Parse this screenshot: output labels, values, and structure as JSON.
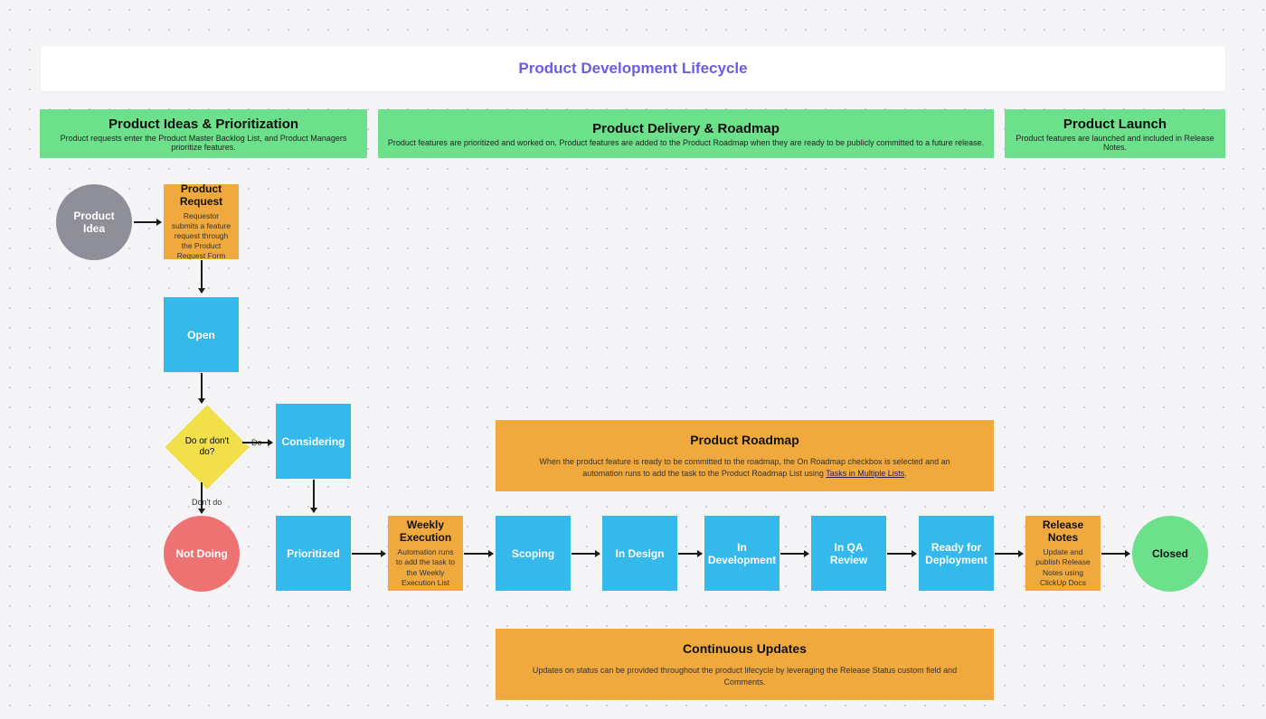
{
  "title": "Product Development Lifecycle",
  "phases": [
    {
      "title": "Product Ideas & Prioritization",
      "sub": "Product requests enter the Product Master Backlog List, and Product Managers prioritize features."
    },
    {
      "title": "Product Delivery & Roadmap",
      "sub": "Product features are prioritized and worked on. Product features are added to the Product Roadmap when they are ready to be publicly committed to a future release."
    },
    {
      "title": "Product Launch",
      "sub": "Product features are launched and included in Release Notes."
    }
  ],
  "idea_node": "Product Idea",
  "request_node": {
    "title": "Product Request",
    "sub": "Requestor submits a feature request through the Product Request Form"
  },
  "open_node": "Open",
  "decision": "Do or don't do?",
  "decision_do": "Do",
  "decision_dont": "Don't do",
  "not_doing": "Not Doing",
  "considering": "Considering",
  "weekly": {
    "title": "Weekly Execution",
    "sub": "Automation runs to add the task to the Weekly Execution List"
  },
  "pipeline": [
    "Prioritized",
    "Scoping",
    "In Design",
    "In Development",
    "In QA Review",
    "Ready for Deployment"
  ],
  "release_notes": {
    "title": "Release Notes",
    "sub": "Update and publish Release Notes using ClickUp Docs"
  },
  "closed": "Closed",
  "roadmap": {
    "title": "Product Roadmap",
    "body": "When the product feature is ready to be committed to the roadmap, the On Roadmap checkbox is selected and an automation runs to add the task to the Product Roadmap List using ",
    "link": "Tasks in Multiple Lists"
  },
  "updates": {
    "title": "Continuous Updates",
    "body": "Updates on status can be provided throughout the product lifecycle by leveraging the Release Status custom field and Comments."
  }
}
